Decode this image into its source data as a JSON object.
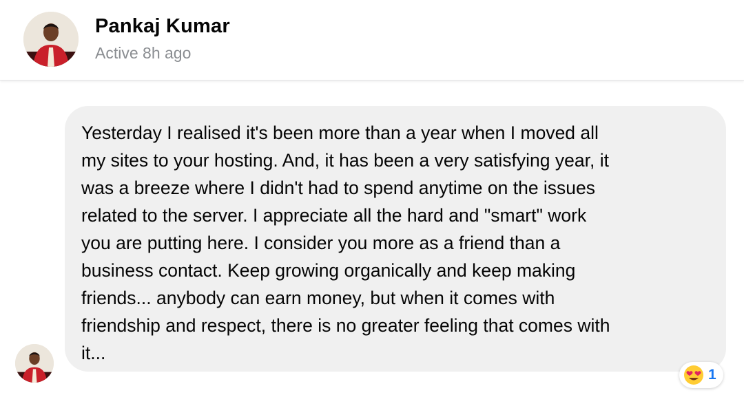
{
  "contact": {
    "name": "Pankaj Kumar",
    "status": "Active 8h ago"
  },
  "message": {
    "text": "Yesterday I realised it's been more than a year when I moved all\nmy sites to your hosting. And, it has been a very satisfying year, it\nwas a breeze where I didn't had to spend anytime on the issues\nrelated to the server. I appreciate all the hard and \"smart\" work\nyou are putting here. I consider you more as a friend than a\nbusiness contact. Keep growing organically and keep making\nfriends... anybody can earn money, but when it comes with\nfriendship and respect, there is no greater feeling that comes with\nit...",
    "reaction": {
      "icon": "heart-eyes-emoji-icon",
      "count": "1",
      "count_color": "#1877f2"
    }
  },
  "colors": {
    "bubble_background": "#f0f0f0",
    "status_text": "#8a8d91",
    "name_text": "#050505"
  }
}
